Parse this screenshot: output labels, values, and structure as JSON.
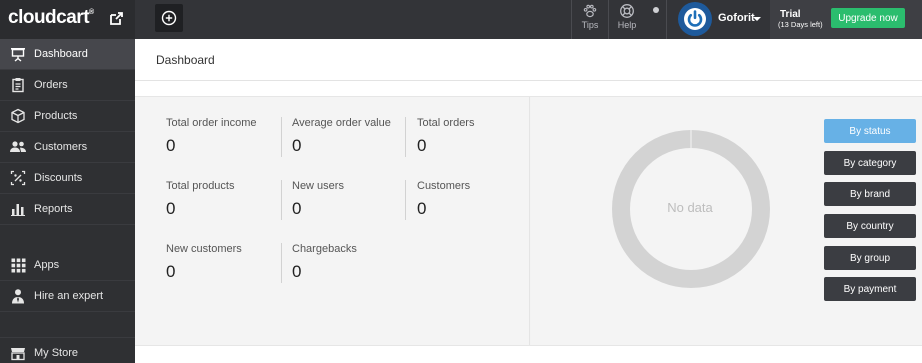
{
  "brand": {
    "logo_text": "cloudcart",
    "logo_mark": "®"
  },
  "topbar": {
    "tips_label": "Tips",
    "help_label": "Help",
    "user_name": "Goforit",
    "trial_title": "Trial",
    "trial_days": "(13 Days left)",
    "upgrade_label": "Upgrade now"
  },
  "sidebar": {
    "items": [
      {
        "label": "Dashboard",
        "icon": "presentation-icon"
      },
      {
        "label": "Orders",
        "icon": "clipboard-icon"
      },
      {
        "label": "Products",
        "icon": "box-icon"
      },
      {
        "label": "Customers",
        "icon": "users-icon"
      },
      {
        "label": "Discounts",
        "icon": "discount-icon"
      },
      {
        "label": "Reports",
        "icon": "bar-chart-icon"
      },
      {
        "label": "Apps",
        "icon": "grid-icon"
      },
      {
        "label": "Hire an expert",
        "icon": "expert-icon"
      },
      {
        "label": "My Store",
        "icon": "store-icon"
      }
    ]
  },
  "page": {
    "title": "Dashboard"
  },
  "stats": [
    {
      "label": "Total order income",
      "value": "0"
    },
    {
      "label": "Average order value",
      "value": "0"
    },
    {
      "label": "Total orders",
      "value": "0"
    },
    {
      "label": "Total products",
      "value": "0"
    },
    {
      "label": "New users",
      "value": "0"
    },
    {
      "label": "Customers",
      "value": "0"
    },
    {
      "label": "New customers",
      "value": "0"
    },
    {
      "label": "Chargebacks",
      "value": "0"
    }
  ],
  "chart": {
    "empty_text": "No data"
  },
  "filters": [
    {
      "label": "By status",
      "selected": true
    },
    {
      "label": "By category",
      "selected": false
    },
    {
      "label": "By brand",
      "selected": false
    },
    {
      "label": "By country",
      "selected": false
    },
    {
      "label": "By group",
      "selected": false
    },
    {
      "label": "By payment",
      "selected": false
    }
  ],
  "colors": {
    "topbar": "#333438",
    "sidebar": "#2f3033",
    "upgrade": "#2bbd6e",
    "selected_filter": "#67b1e6",
    "filter": "#3b3d42",
    "donut": "#d3d3d3"
  }
}
